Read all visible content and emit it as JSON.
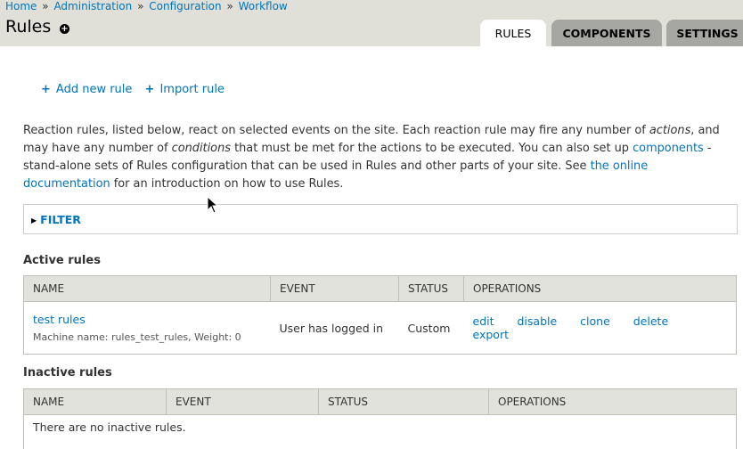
{
  "breadcrumb": [
    {
      "label": "Home"
    },
    {
      "label": "Administration"
    },
    {
      "label": "Configuration"
    },
    {
      "label": "Workflow"
    }
  ],
  "breadcrumb_sep": "»",
  "page": {
    "title": "Rules",
    "title_action_symbol": "+"
  },
  "tabs": [
    {
      "label": "RULES",
      "active": true
    },
    {
      "label": "COMPONENTS",
      "active": false
    },
    {
      "label": "SETTINGS",
      "active": false
    }
  ],
  "actions": {
    "add_rule": "Add new rule",
    "import_rule": "Import rule",
    "plus": "+"
  },
  "description": {
    "p1": "Reaction rules, listed below, react on selected events on the site. Each reaction rule may fire any number of ",
    "actions_word": "actions",
    "p2": ", and may have any number of ",
    "conditions_word": "conditions",
    "p3": " that must be met for the actions to be executed. You can also set up ",
    "components_link": "components",
    "p4": " - stand-alone sets of Rules configuration that can be used in Rules and other parts of your site. See ",
    "docs_link": "the online documentation",
    "p5": " for an introduction on how to use Rules."
  },
  "filter": {
    "label": "FILTER"
  },
  "active_rules": {
    "title": "Active rules",
    "columns": [
      "NAME",
      "EVENT",
      "STATUS",
      "OPERATIONS"
    ],
    "rows": [
      {
        "name": "test rules",
        "machine": "Machine name: rules_test_rules, Weight: 0",
        "event": "User has logged in",
        "status": "Custom",
        "ops": [
          "edit",
          "disable",
          "clone",
          "delete",
          "export"
        ]
      }
    ]
  },
  "inactive_rules": {
    "title": "Inactive rules",
    "columns": [
      "NAME",
      "EVENT",
      "STATUS",
      "OPERATIONS"
    ],
    "empty": "There are no inactive rules."
  },
  "colors": {
    "link": "#0074bd",
    "header_bg": "#e0e0d8",
    "tab_bg": "#a6a7a2"
  }
}
